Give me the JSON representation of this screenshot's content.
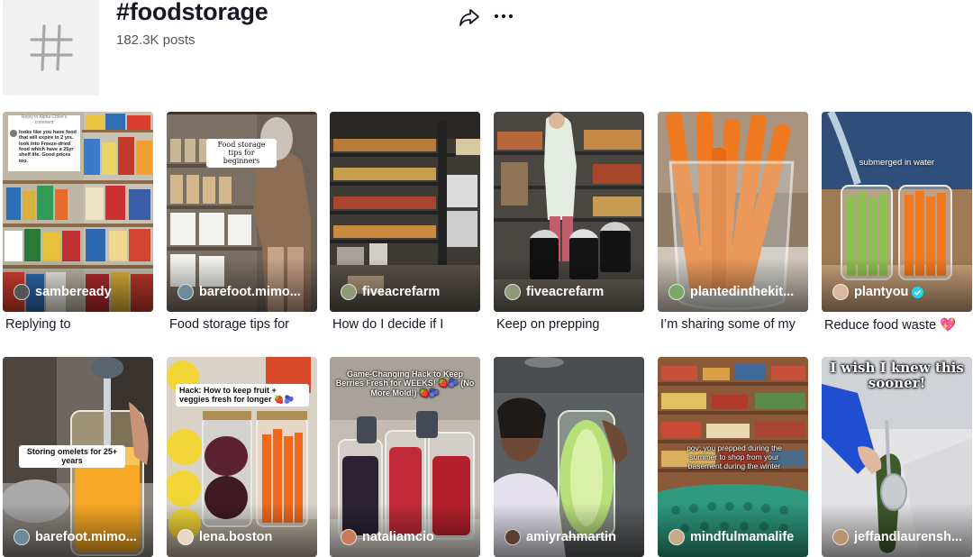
{
  "header": {
    "title": "#foodstorage",
    "posts_count": "182.3K posts"
  },
  "icons": {
    "tag": "hashtag-icon",
    "share": "share-icon",
    "more": "more-options-icon"
  },
  "videos": [
    {
      "author": "sambeready",
      "caption": "Replying to",
      "overlay": "looks like you have food that will expire in 2 yrs. look into Freeze-dried food which have a 25yr shelf life. Good prices too.",
      "overlay_top": "Reply to Alpha Chloe's comment"
    },
    {
      "author": "barefoot.mimo...",
      "caption": "Food storage tips for",
      "overlay": "Food storage tips for beginners"
    },
    {
      "author": "fiveacrefarm",
      "caption": "How do I decide if I"
    },
    {
      "author": "fiveacrefarm",
      "caption": "Keep on prepping"
    },
    {
      "author": "plantedinthekit...",
      "caption": "I’m sharing some of my"
    },
    {
      "author": "plantyou",
      "caption": "Reduce food waste",
      "caption_emoji": "💖",
      "verified": true,
      "overlay": "submerged in water"
    },
    {
      "author": "barefoot.mimo...",
      "overlay": "Storing omelets for 25+ years"
    },
    {
      "author": "lena.boston",
      "overlay": "Hack: How to keep fruit + veggies fresh for longer 🍓🫐"
    },
    {
      "author": "nataliamcio",
      "overlay": "Game-Changing Hack to Keep Berries Fresh for WEEKS! 🍓🫐 (No More Mold!) 🍓🫐"
    },
    {
      "author": "amiyrahmartin"
    },
    {
      "author": "mindfulmamalife",
      "overlay": "pov: you prepped during the summer to shop from your basement during the winter"
    },
    {
      "author": "jeffandlaurensh...",
      "overlay": "I wish I knew this sooner!"
    }
  ]
}
